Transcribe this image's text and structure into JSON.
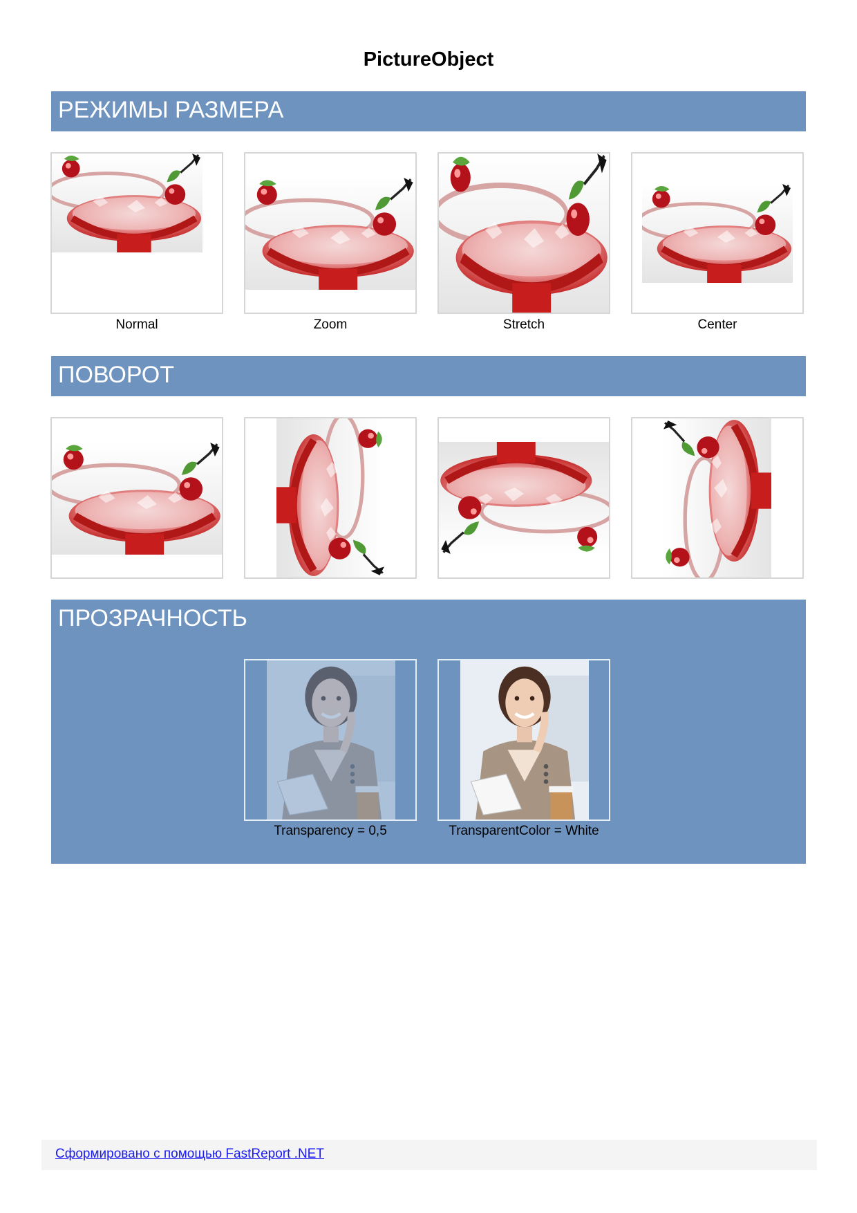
{
  "page": {
    "title": "PictureObject"
  },
  "sections": {
    "size_modes": {
      "title": "РЕЖИМЫ РАЗМЕРА",
      "captions": [
        "Normal",
        "Zoom",
        "Stretch",
        "Center"
      ]
    },
    "rotation": {
      "title": "ПОВОРОТ"
    },
    "transparency": {
      "title": "ПРОЗРАЧНОСТЬ",
      "captions": [
        "Transparency = 0,5",
        "TransparentColor = White"
      ]
    }
  },
  "footer": {
    "link_text": "Сформировано с помощью FastReport .NET"
  },
  "colors": {
    "band": "#6e93bf",
    "frame_border": "#d6d6d6",
    "link": "#1a1aee",
    "footer_bg": "#f4f4f4"
  },
  "images": {
    "cocktail": "red-cocktail-photo",
    "portrait": "businesswoman-photo"
  }
}
